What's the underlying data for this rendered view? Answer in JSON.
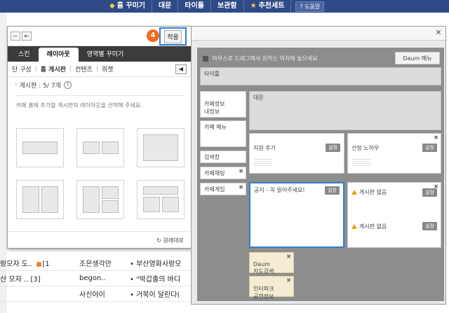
{
  "topnav": {
    "items": [
      {
        "label": "홈 꾸미기",
        "icon": "cube-icon"
      },
      {
        "label": "대문"
      },
      {
        "label": "타이틀"
      },
      {
        "label": "보관함"
      },
      {
        "label": "추천세트",
        "icon": "star-icon"
      }
    ],
    "help_label": "? 도움말"
  },
  "left_panel": {
    "step_number": "4",
    "apply_label": "적용",
    "tabs": [
      "스킨",
      "레이아웃",
      "영역별 꾸미기"
    ],
    "active_tab": "레이아웃",
    "subtabs": [
      "단 구성",
      "홈 게시판",
      "컨텐츠",
      "위젯"
    ],
    "active_subtab": "홈 게시판",
    "board_count": "게시판 : 5/ 7개",
    "description": "카페 홈에 추가할 게시판의 레이아웃을 선택해 주세요.",
    "restore_label": "원래대로"
  },
  "right_panel": {
    "hint": "마우스로 드래그해서 원하는 위치에 놓으세요",
    "daum_menu": "Daum 메뉴",
    "title_block": "타이틀",
    "left_blocks": [
      {
        "label": "카페정보\n내정보"
      },
      {
        "label": "카페 메뉴"
      },
      {
        "label": "검색창"
      },
      {
        "label": "카페채팅"
      },
      {
        "label": "카페게임"
      }
    ],
    "main_block": "대문",
    "board_blocks": [
      {
        "label": "지원 후기",
        "button": "설정"
      },
      {
        "label": "선정 노하우",
        "button": "설정"
      },
      {
        "label": "공지 - 꼭 읽어주세요!",
        "button": "설정"
      },
      {
        "label": "게시판 없음",
        "button": "설정"
      },
      {
        "label": "게시판 없음",
        "button": "설정"
      }
    ],
    "bottom_blocks": [
      {
        "label": "Daum\n지도검색"
      },
      {
        "label": "인터파크\n공연정보"
      }
    ]
  },
  "background": {
    "rows": [
      {
        "c1": "랑모자 도..",
        "c1b": "[1]",
        "c2": "조은생각만",
        "c3": "부산영화사랑모"
      },
      {
        "c1": "산 모자 ..",
        "c1b": "[3]",
        "c2": "begon..",
        "c3": "\"박갑출의 바디"
      },
      {
        "c1": "",
        "c1b": "",
        "c2": "사신아이",
        "c3": "거북이 달린다("
      }
    ]
  }
}
